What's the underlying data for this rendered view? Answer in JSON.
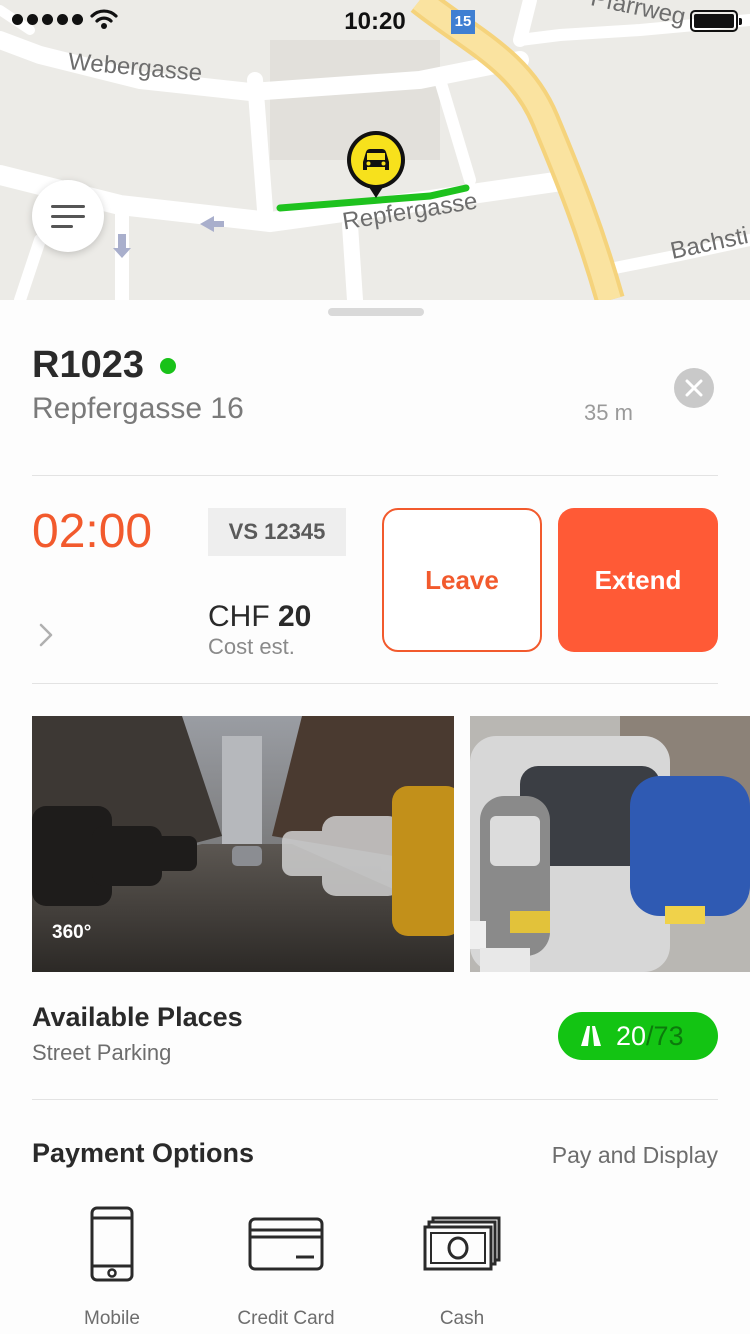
{
  "status_bar": {
    "time": "10:20"
  },
  "map": {
    "streets": [
      "Webergasse",
      "Repfergasse",
      "Bachsti",
      "Pfarrweg"
    ],
    "route_badge": "15"
  },
  "parking": {
    "zone_code": "R1023",
    "address": "Repfergasse 16",
    "distance": "35 m"
  },
  "session": {
    "timer": "02:00",
    "plate": "VS 12345",
    "currency": "CHF",
    "cost_value": "20",
    "cost_label": "Cost est.",
    "leave_label": "Leave",
    "extend_label": "Extend"
  },
  "photos": {
    "first_label": "360°"
  },
  "availability": {
    "title": "Available Places",
    "subtitle": "Street Parking",
    "available": "20",
    "total": "/73"
  },
  "payment": {
    "title": "Payment Options",
    "type": "Pay and Display",
    "options": [
      {
        "label": "Mobile",
        "icon": "mobile-phone-icon"
      },
      {
        "label": "Credit Card",
        "icon": "credit-card-icon"
      },
      {
        "label": "Cash",
        "icon": "cash-icon"
      }
    ]
  },
  "colors": {
    "accent": "#ff5a36",
    "available_green": "#13c413",
    "route_green": "#1ec21e",
    "car_pin_yellow": "#f7e11c"
  }
}
